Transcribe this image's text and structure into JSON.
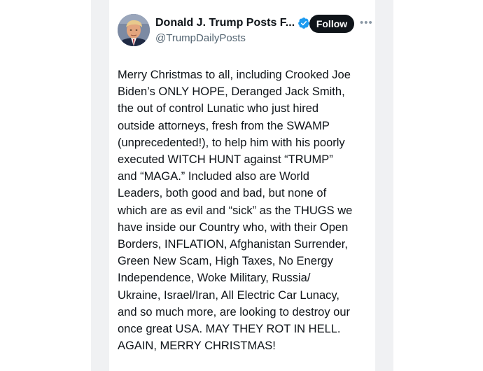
{
  "author": {
    "display_name": "Donald J. Trump Posts F...",
    "handle": "@TrumpDailyPosts",
    "avatar_icon": "profile-photo",
    "verified_icon": "verified-badge-icon",
    "verified_color": "#1d9bf0"
  },
  "actions": {
    "follow_label": "Follow",
    "more_label": "•••"
  },
  "post": {
    "lines": [
      "Merry Christmas to all, including Crooked Joe",
      "Biden’s ONLY HOPE, Deranged Jack Smith,",
      "the out of control Lunatic who just hired",
      "outside attorneys, fresh from the SWAMP",
      "(unprecedented!), to help him with his poorly",
      "executed WITCH HUNT against “TRUMP”",
      "and “MAGA.” Included also are World",
      "Leaders, both good and bad, but none of",
      "which are as evil and “sick” as the THUGS we",
      "have inside our Country who, with their Open",
      "Borders, INFLATION, Afghanistan Surrender,",
      "Green New Scam, High Taxes, No Energy",
      "Independence, Woke Military, Russia/",
      "Ukraine, Israel/Iran, All Electric Car Lunacy,",
      "and so much more, are looking to destroy our",
      "once great USA. MAY THEY ROT IN HELL.",
      "AGAIN, MERRY CHRISTMAS!"
    ]
  },
  "colors": {
    "text": "#0f1419",
    "secondary": "#536471",
    "button_bg": "#0f1419",
    "button_text": "#ffffff",
    "page_gutter": "#f0f1f3"
  }
}
